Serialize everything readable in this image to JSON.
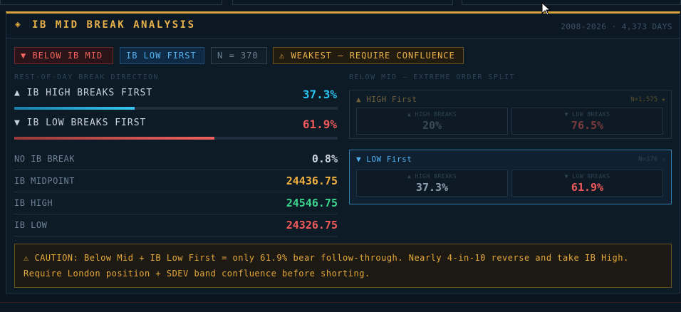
{
  "header": {
    "title": "IB MID BREAK ANALYSIS",
    "range": "2008-2026 · 4,373 DAYS"
  },
  "badges": {
    "below": "▼ BELOW IB MID",
    "low_first": "IB LOW FIRST",
    "n": "N = 370",
    "weakest": "⚠ WEAKEST — REQUIRE CONFLUENCE"
  },
  "left": {
    "section_title": "REST-OF-DAY BREAK DIRECTION",
    "high_breaks": {
      "label": "▲ IB HIGH BREAKS FIRST",
      "pct": "37.3%",
      "value": 37.3
    },
    "low_breaks": {
      "label": "▼ IB LOW BREAKS FIRST",
      "pct": "61.9%",
      "value": 61.9
    },
    "rows": [
      {
        "label": "NO IB BREAK",
        "value": "0.8%"
      },
      {
        "label": "IB MIDPOINT",
        "value": "24436.75"
      },
      {
        "label": "IB HIGH",
        "value": "24546.75"
      },
      {
        "label": "IB LOW",
        "value": "24326.75"
      }
    ]
  },
  "right": {
    "section_title": "BELOW MID — EXTREME ORDER SPLIT",
    "high_first": {
      "title": "▲ HIGH First",
      "n": "N=1,575 ★",
      "high_label": "▲ HIGH BREAKS",
      "high_value": "20%",
      "low_label": "▼ LOW BREAKS",
      "low_value": "76.5%"
    },
    "low_first": {
      "title": "▼ LOW First",
      "n": "N=370 ⚠",
      "high_label": "▲ HIGH BREAKS",
      "high_value": "37.3%",
      "low_label": "▼ LOW BREAKS",
      "low_value": "61.9%"
    }
  },
  "caution": {
    "line1": "⚠ CAUTION: Below Mid + IB Low First = only 61.9% bear follow-through. Nearly 4-in-10 reverse and take IB High.",
    "line2": "Require London position + SDEV band confluence before shorting."
  },
  "colors": {
    "accent": "#e6b04a",
    "cyan": "#29c3f0",
    "red": "#f05a5a",
    "green": "#3cd48c",
    "gold": "#f0b040"
  },
  "icons": {
    "header": "diamond-icon",
    "cursor": "mouse-pointer-icon"
  }
}
